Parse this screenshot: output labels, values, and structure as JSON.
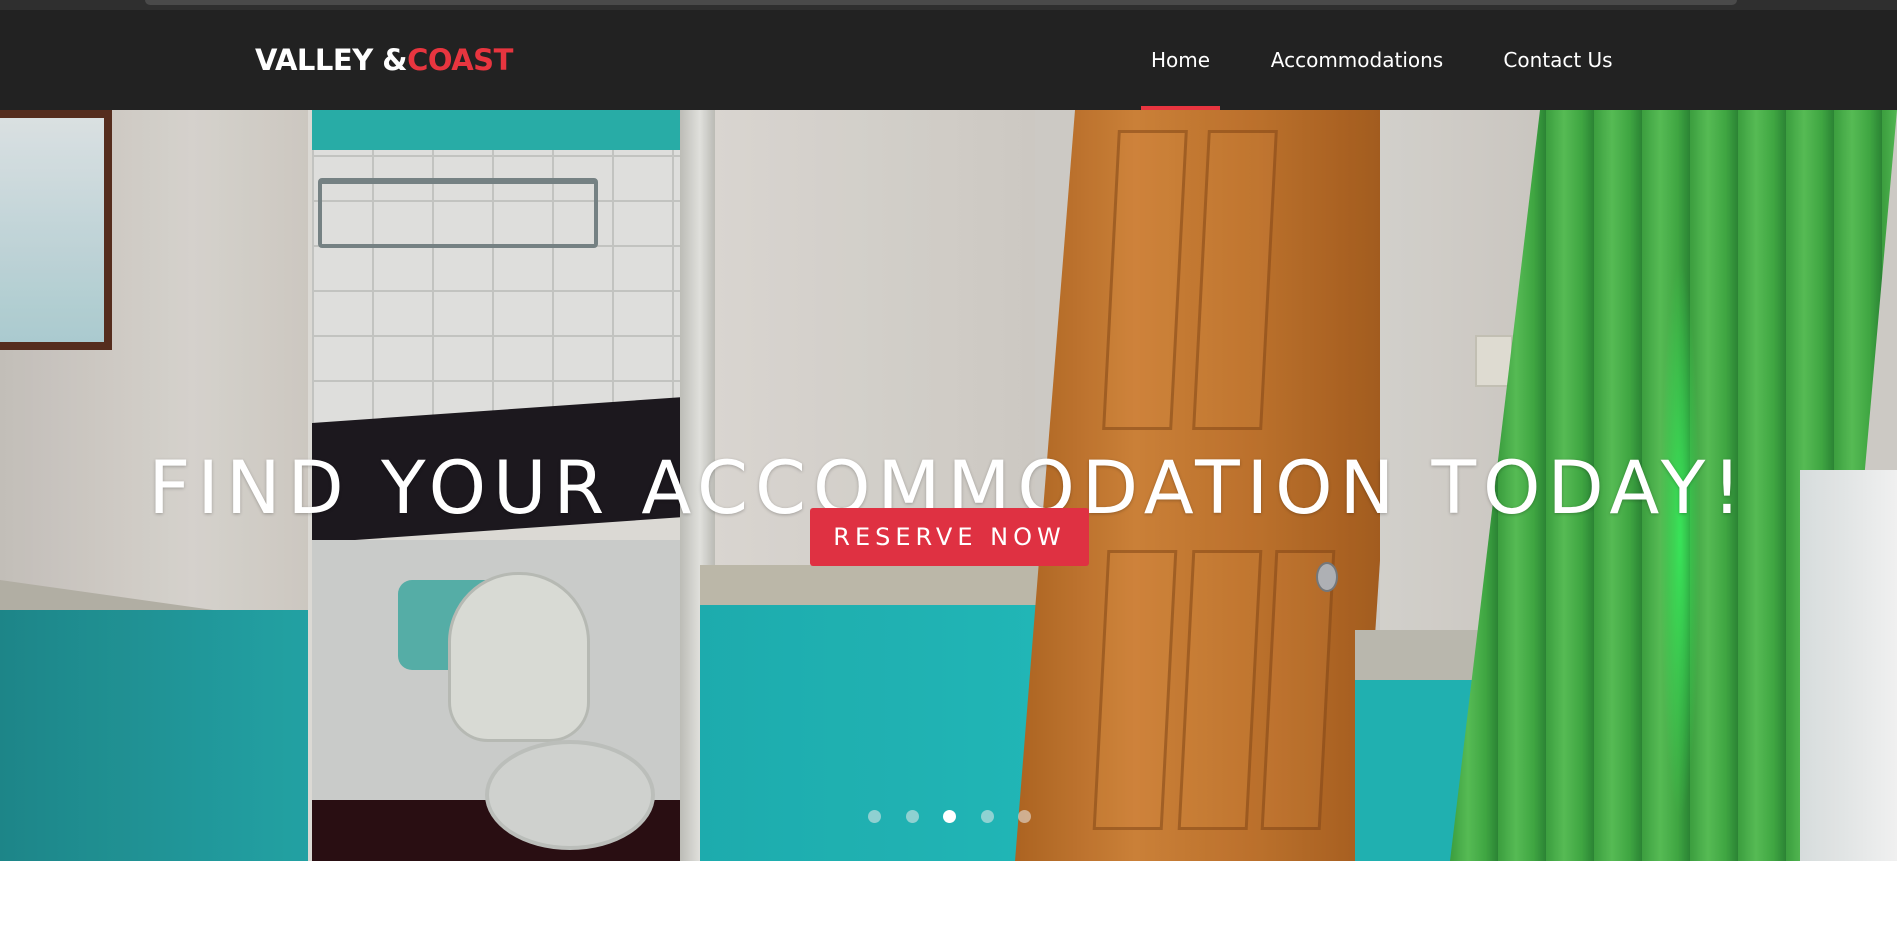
{
  "brand": {
    "name_part1": "VALLEY &",
    "name_part2": "COAST",
    "accent_color": "#e8353f"
  },
  "nav": {
    "items": [
      {
        "label": "Home",
        "active": true
      },
      {
        "label": "Accommodations",
        "active": false
      },
      {
        "label": "Contact Us",
        "active": false
      }
    ]
  },
  "hero": {
    "headline": "FIND YOUR ACCOMMODATION TODAY!",
    "cta_label": "RESERVE NOW",
    "cta_color": "#df3142",
    "carousel": {
      "slide_count": 5,
      "active_index": 2
    }
  },
  "colors": {
    "navbar_bg": "#222222",
    "text": "#ffffff"
  }
}
